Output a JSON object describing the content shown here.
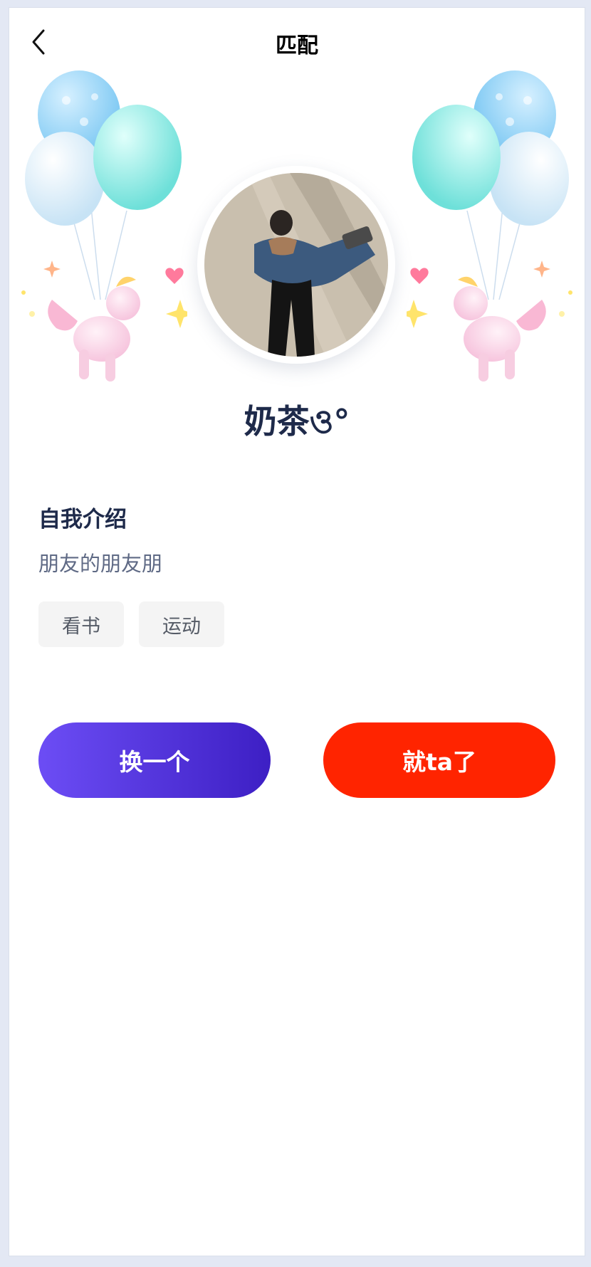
{
  "header": {
    "title": "匹配",
    "back_icon": "chevron-left-icon"
  },
  "profile": {
    "nickname": "奶茶ও°",
    "avatar_icon": "user-photo-avatar"
  },
  "intro": {
    "title": "自我介绍",
    "text": "朋友的朋友朋"
  },
  "tags": [
    "看书",
    "运动"
  ],
  "actions": {
    "swap_label": "换一个",
    "choose_label": "就ta了"
  },
  "colors": {
    "swap_gradient": [
      "#6c4df5",
      "#3d1fc4"
    ],
    "choose": "#ff2400",
    "heading": "#1e2a4a"
  }
}
